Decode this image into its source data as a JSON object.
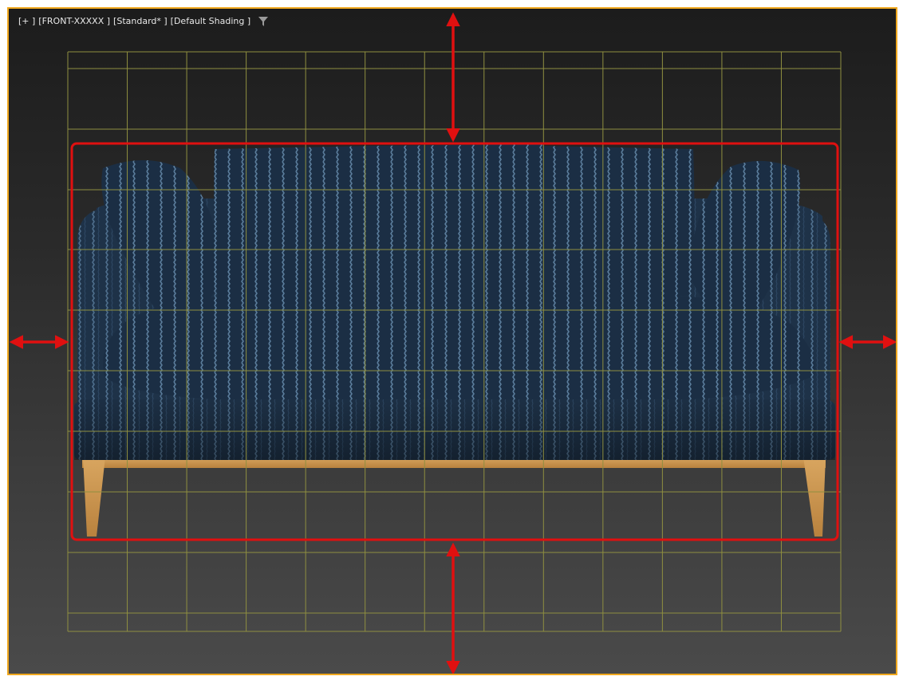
{
  "viewport": {
    "labels": {
      "plus": "[+ ]",
      "view": "[FRONT-XXXXX ]",
      "preset": "[Standard* ]",
      "shading": "[Default Shading ]"
    },
    "filter_icon": "filter-funnel-icon",
    "border_color": "#f0a81e",
    "grid_color": "#8f8f40",
    "annotation_color": "#e01010"
  },
  "sofa": {
    "fabric_color": "#1f3349",
    "stripe_color": "#4d6d8a",
    "wood_color": "#c8914a"
  }
}
